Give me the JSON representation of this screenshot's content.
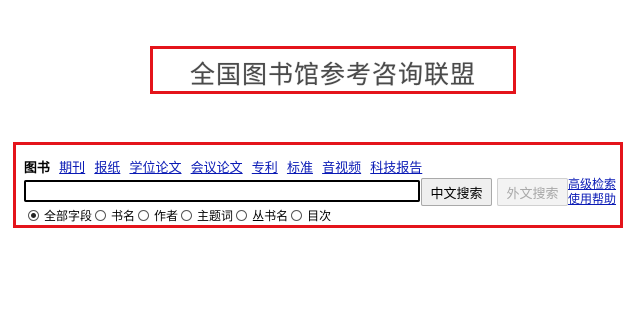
{
  "logo": {
    "text": "全国图书馆参考咨询联盟"
  },
  "tabs": {
    "active": "图书",
    "links": [
      "期刊",
      "报纸",
      "学位论文",
      "会议论文",
      "专利",
      "标准",
      "音视频",
      "科技报告"
    ]
  },
  "search": {
    "value": ""
  },
  "buttons": {
    "chinese_search": "中文搜索",
    "foreign_search": "外文搜索"
  },
  "side_links": {
    "advanced": "高级检索",
    "help": "使用帮助"
  },
  "fields": {
    "selected": "全部字段",
    "options": [
      "全部字段",
      "书名",
      "作者",
      "主题词",
      "丛书名",
      "目次"
    ]
  },
  "colors": {
    "highlight_border": "#e4141b",
    "link": "#0a1ab5"
  }
}
